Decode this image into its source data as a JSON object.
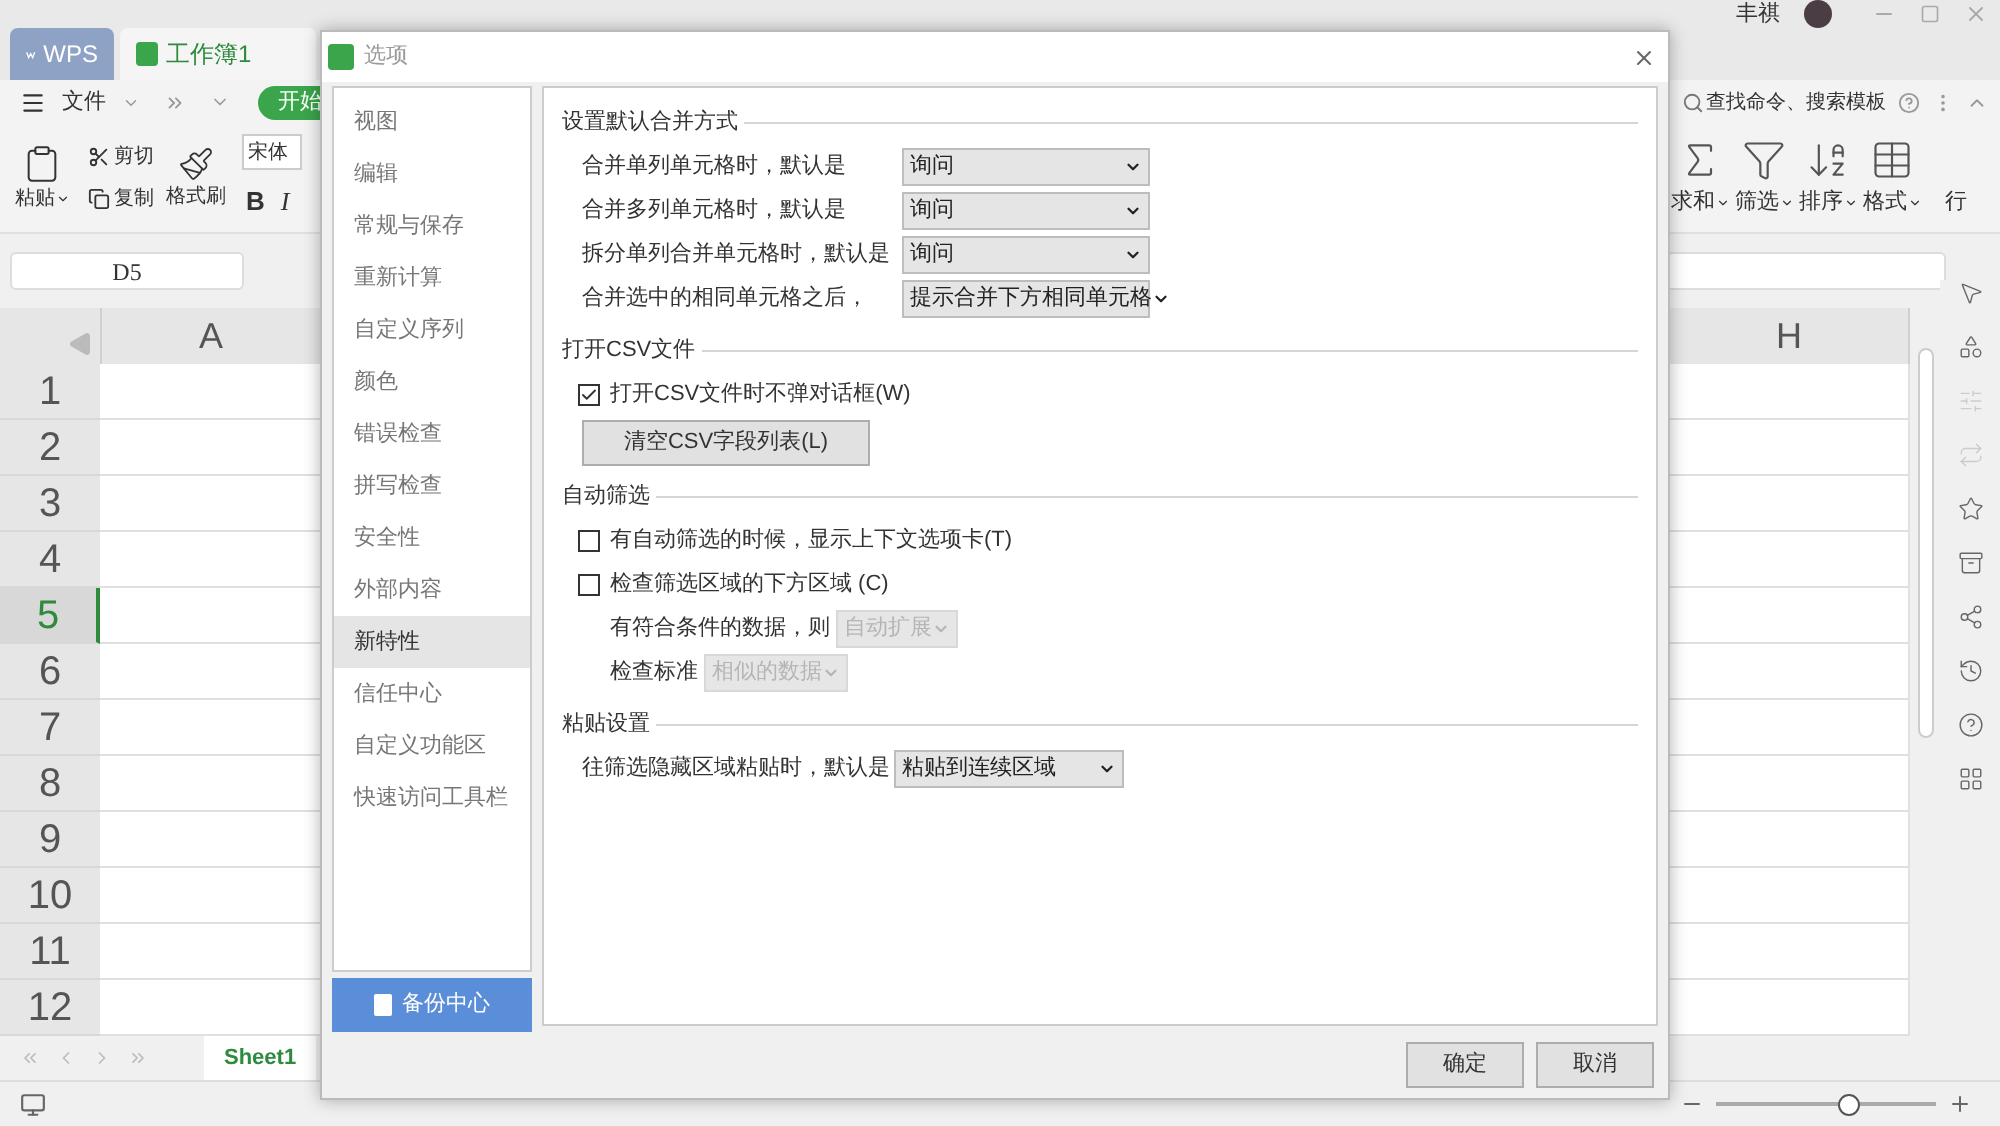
{
  "app_tabs": [
    {
      "label": "WPS",
      "selected": false
    },
    {
      "label": "工作簿1",
      "selected": true
    }
  ],
  "user": {
    "name": "丰祺"
  },
  "menu": {
    "file": "文件",
    "start_tab": "开始",
    "search": "查找命令、搜索模板"
  },
  "ribbon_left": {
    "paste": "粘贴",
    "cut": "剪切",
    "copy": "复制",
    "format_painter": "格式刷",
    "font": "宋体",
    "bold": "B",
    "italic": "I"
  },
  "ribbon_right": [
    {
      "label": "求和",
      "kind": "sum"
    },
    {
      "label": "筛选",
      "kind": "filter"
    },
    {
      "label": "排序",
      "kind": "sort"
    },
    {
      "label": "格式",
      "kind": "format"
    },
    {
      "label": "行",
      "kind": "row"
    }
  ],
  "name_box": "D5",
  "zoom": {
    "level": 0.6
  },
  "columns": [
    "A",
    "H"
  ],
  "rows": [
    {
      "label": "1",
      "selected": false
    },
    {
      "label": "2",
      "selected": false
    },
    {
      "label": "3",
      "selected": false
    },
    {
      "label": "4",
      "selected": false
    },
    {
      "label": "5",
      "selected": true
    },
    {
      "label": "6",
      "selected": false
    },
    {
      "label": "7",
      "selected": false
    },
    {
      "label": "8",
      "selected": false
    },
    {
      "label": "9",
      "selected": false
    },
    {
      "label": "10",
      "selected": false
    },
    {
      "label": "11",
      "selected": false
    },
    {
      "label": "12",
      "selected": false
    }
  ],
  "sheet_tabs": [
    {
      "label": "Sheet1",
      "selected": true
    }
  ],
  "dialog": {
    "title": "选项",
    "nav": [
      {
        "label": "视图",
        "selected": false
      },
      {
        "label": "编辑",
        "selected": false
      },
      {
        "label": "常规与保存",
        "selected": false
      },
      {
        "label": "重新计算",
        "selected": false
      },
      {
        "label": "自定义序列",
        "selected": false
      },
      {
        "label": "颜色",
        "selected": false
      },
      {
        "label": "错误检查",
        "selected": false
      },
      {
        "label": "拼写检查",
        "selected": false
      },
      {
        "label": "安全性",
        "selected": false
      },
      {
        "label": "外部内容",
        "selected": false
      },
      {
        "label": "新特性",
        "selected": true
      },
      {
        "label": "信任中心",
        "selected": false
      },
      {
        "label": "自定义功能区",
        "selected": false
      },
      {
        "label": "快速访问工具栏",
        "selected": false
      }
    ],
    "backup": "备份中心",
    "sections": [
      {
        "title": "设置默认合并方式",
        "items": [
          {
            "kind": "select",
            "label": "合并单列单元格时，默认是",
            "value": "询问",
            "disabled": false
          },
          {
            "kind": "select",
            "label": "合并多列单元格时，默认是",
            "value": "询问",
            "disabled": false
          },
          {
            "kind": "select",
            "label": "拆分单列合并单元格时，默认是",
            "value": "询问",
            "disabled": false
          },
          {
            "kind": "select",
            "label": "合并选中的相同单元格之后，",
            "value": "提示合并下方相同单元格",
            "disabled": false
          }
        ]
      },
      {
        "title": "打开CSV文件",
        "items": [
          {
            "kind": "checkbox",
            "label": "打开CSV文件时不弹对话框(W)",
            "checked": true
          },
          {
            "kind": "button",
            "label": "清空CSV字段列表(L)"
          }
        ]
      },
      {
        "title": "自动筛选",
        "items": [
          {
            "kind": "checkbox",
            "label": "有自动筛选的时候，显示上下文选项卡(T)",
            "checked": false
          },
          {
            "kind": "checkbox",
            "label": "检查筛选区域的下方区域 (C)",
            "checked": false
          },
          {
            "kind": "subselect",
            "label": "有符合条件的数据，则",
            "value": "自动扩展",
            "disabled": true
          },
          {
            "kind": "subselect",
            "label": "检查标准",
            "value": "相似的数据",
            "disabled": true
          }
        ]
      },
      {
        "title": "粘贴设置",
        "items": [
          {
            "kind": "inlineselect",
            "label": "往筛选隐藏区域粘贴时，默认是",
            "value": "粘贴到连续区域",
            "disabled": false
          }
        ]
      }
    ],
    "buttons": [
      "确定",
      "取消"
    ]
  }
}
